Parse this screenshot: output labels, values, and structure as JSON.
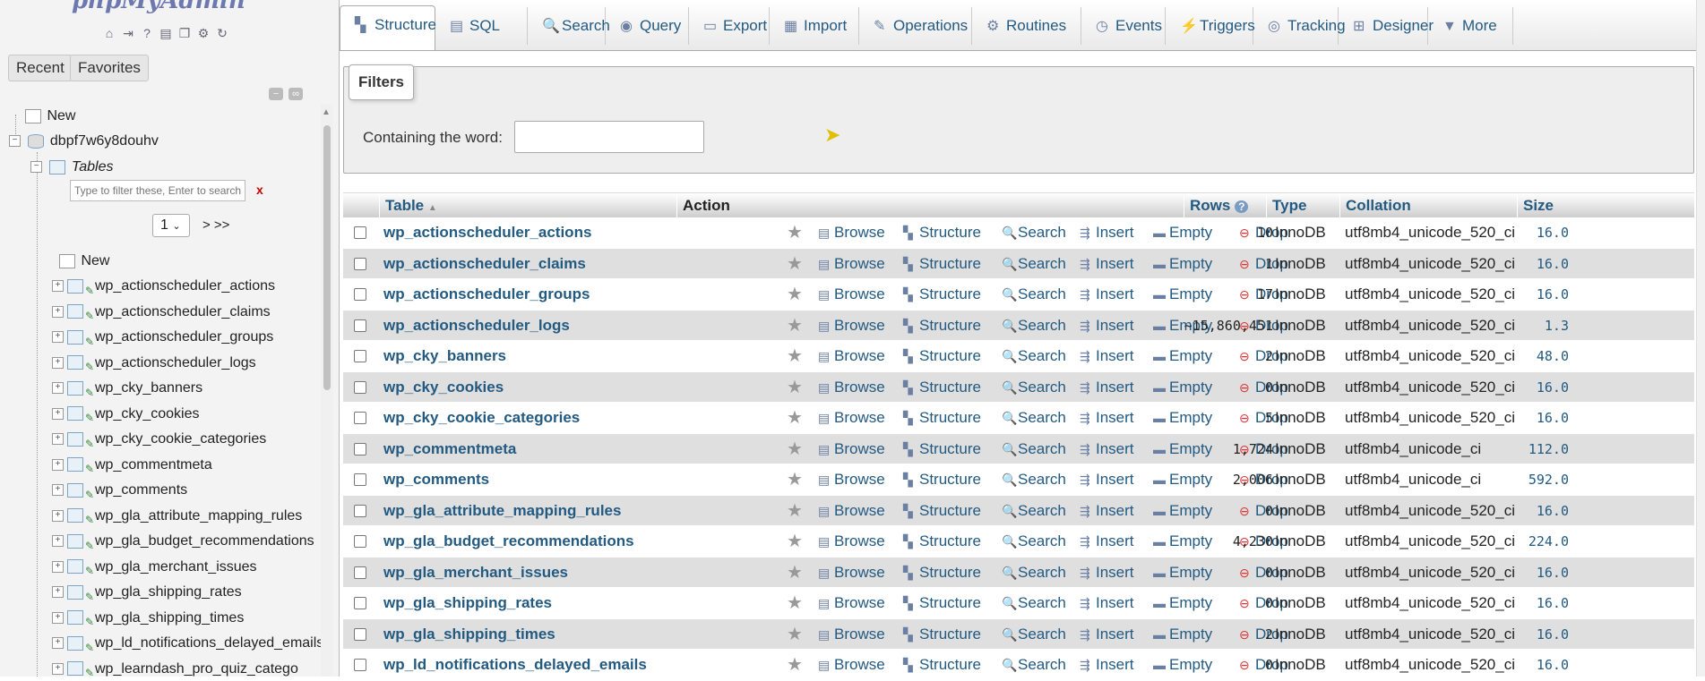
{
  "nav": {
    "logo": {
      "main": "phpMyAdmin"
    },
    "recent_label": "Recent",
    "favorites_label": "Favorites",
    "new_label": "New",
    "database": "dbpf7w6y8douhv",
    "tables_label": "Tables",
    "filter_placeholder": "Type to filter these, Enter to search a",
    "filter_clear": "x",
    "page_value": "1",
    "page_next": "> >>",
    "tables_new": "New",
    "tree_tables": [
      "wp_actionscheduler_actions",
      "wp_actionscheduler_claims",
      "wp_actionscheduler_groups",
      "wp_actionscheduler_logs",
      "wp_cky_banners",
      "wp_cky_cookies",
      "wp_cky_cookie_categories",
      "wp_commentmeta",
      "wp_comments",
      "wp_gla_attribute_mapping_rules",
      "wp_gla_budget_recommendations",
      "wp_gla_merchant_issues",
      "wp_gla_shipping_rates",
      "wp_gla_shipping_times",
      "wp_ld_notifications_delayed_emails",
      "wp_learndash_pro_quiz_catego"
    ]
  },
  "tabs": [
    {
      "label": "Structure",
      "icon": "structure-icon"
    },
    {
      "label": "SQL",
      "icon": "sql-icon"
    },
    {
      "label": "Search",
      "icon": "search-icon"
    },
    {
      "label": "Query",
      "icon": "query-icon"
    },
    {
      "label": "Export",
      "icon": "export-icon"
    },
    {
      "label": "Import",
      "icon": "import-icon"
    },
    {
      "label": "Operations",
      "icon": "wrench-icon"
    },
    {
      "label": "Routines",
      "icon": "routines-icon"
    },
    {
      "label": "Events",
      "icon": "clock-icon"
    },
    {
      "label": "Triggers",
      "icon": "triggers-icon"
    },
    {
      "label": "Tracking",
      "icon": "eye-icon"
    },
    {
      "label": "Designer",
      "icon": "designer-icon"
    },
    {
      "label": "More",
      "icon": "chevron-down-icon"
    }
  ],
  "filters": {
    "legend": "Filters",
    "containing_label": "Containing the word:",
    "containing_value": ""
  },
  "table_headers": {
    "table": "Table",
    "action": "Action",
    "rows": "Rows",
    "type": "Type",
    "collation": "Collation",
    "size": "Size"
  },
  "actions": {
    "browse": "Browse",
    "structure": "Structure",
    "search": "Search",
    "insert": "Insert",
    "empty": "Empty",
    "drop": "Drop"
  },
  "rows": [
    {
      "name": "wp_actionscheduler_actions",
      "rows": "10",
      "type": "InnoDB",
      "collation": "utf8mb4_unicode_520_ci",
      "size": "16.0"
    },
    {
      "name": "wp_actionscheduler_claims",
      "rows": "1",
      "type": "InnoDB",
      "collation": "utf8mb4_unicode_520_ci",
      "size": "16.0"
    },
    {
      "name": "wp_actionscheduler_groups",
      "rows": "17",
      "type": "InnoDB",
      "collation": "utf8mb4_unicode_520_ci",
      "size": "16.0"
    },
    {
      "name": "wp_actionscheduler_logs",
      "rows": "~15,860,451",
      "type": "InnoDB",
      "collation": "utf8mb4_unicode_520_ci",
      "size": "1.3"
    },
    {
      "name": "wp_cky_banners",
      "rows": "2",
      "type": "InnoDB",
      "collation": "utf8mb4_unicode_520_ci",
      "size": "48.0"
    },
    {
      "name": "wp_cky_cookies",
      "rows": "0",
      "type": "InnoDB",
      "collation": "utf8mb4_unicode_520_ci",
      "size": "16.0"
    },
    {
      "name": "wp_cky_cookie_categories",
      "rows": "5",
      "type": "InnoDB",
      "collation": "utf8mb4_unicode_520_ci",
      "size": "16.0"
    },
    {
      "name": "wp_commentmeta",
      "rows": "1,724",
      "type": "InnoDB",
      "collation": "utf8mb4_unicode_ci",
      "size": "112.0"
    },
    {
      "name": "wp_comments",
      "rows": "2,006",
      "type": "InnoDB",
      "collation": "utf8mb4_unicode_ci",
      "size": "592.0"
    },
    {
      "name": "wp_gla_attribute_mapping_rules",
      "rows": "0",
      "type": "InnoDB",
      "collation": "utf8mb4_unicode_520_ci",
      "size": "16.0"
    },
    {
      "name": "wp_gla_budget_recommendations",
      "rows": "4,230",
      "type": "InnoDB",
      "collation": "utf8mb4_unicode_520_ci",
      "size": "224.0"
    },
    {
      "name": "wp_gla_merchant_issues",
      "rows": "0",
      "type": "InnoDB",
      "collation": "utf8mb4_unicode_520_ci",
      "size": "16.0"
    },
    {
      "name": "wp_gla_shipping_rates",
      "rows": "0",
      "type": "InnoDB",
      "collation": "utf8mb4_unicode_520_ci",
      "size": "16.0"
    },
    {
      "name": "wp_gla_shipping_times",
      "rows": "2",
      "type": "InnoDB",
      "collation": "utf8mb4_unicode_520_ci",
      "size": "16.0"
    },
    {
      "name": "wp_ld_notifications_delayed_emails",
      "rows": "0",
      "type": "InnoDB",
      "collation": "utf8mb4_unicode_520_ci",
      "size": "16.0"
    }
  ]
}
